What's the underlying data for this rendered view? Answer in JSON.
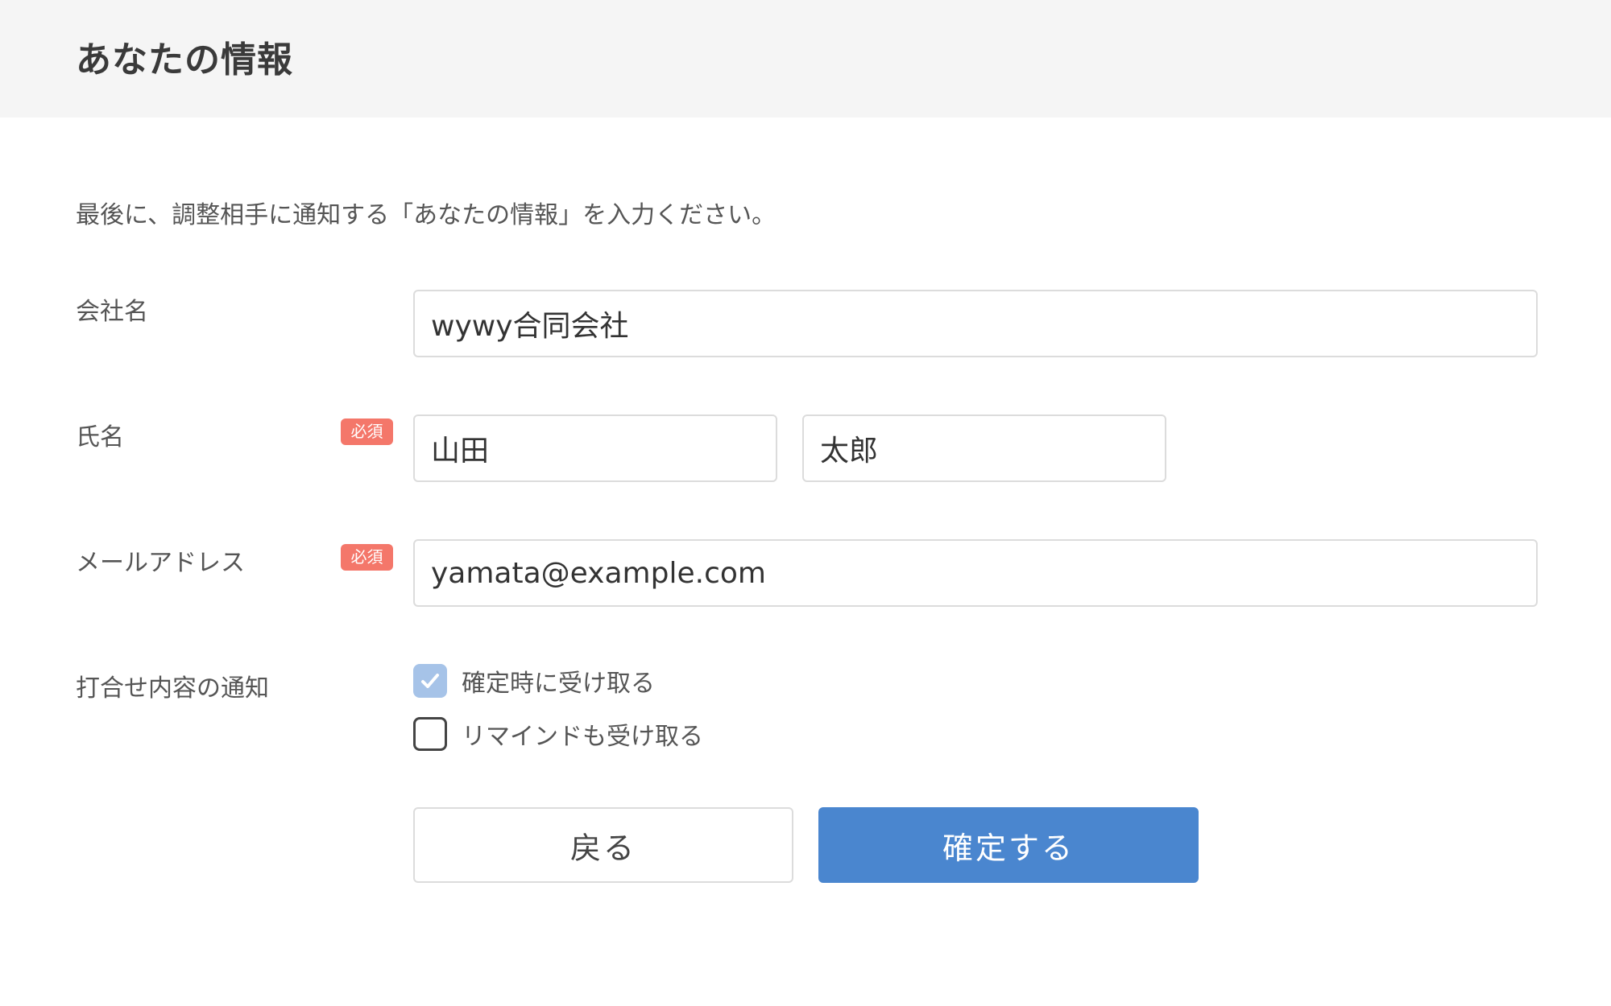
{
  "header": {
    "title": "あなたの情報"
  },
  "intro": "最後に、調整相手に通知する「あなたの情報」を入力ください。",
  "fields": {
    "company": {
      "label": "会社名",
      "value": "wywy合同会社"
    },
    "name": {
      "label": "氏名",
      "badge": "必須",
      "last_name": "山田",
      "first_name": "太郎"
    },
    "email": {
      "label": "メールアドレス",
      "badge": "必須",
      "value": "yamata@example.com"
    }
  },
  "notify": {
    "label": "打合せ内容の通知",
    "options": [
      {
        "label": "確定時に受け取る",
        "checked": true
      },
      {
        "label": "リマインドも受け取る",
        "checked": false
      }
    ]
  },
  "buttons": {
    "back": "戻る",
    "confirm": "確定する"
  },
  "colors": {
    "header_bg": "#f5f5f5",
    "required_badge": "#f4776a",
    "primary": "#4a86cf",
    "checkbox_checked": "#a6c3e8"
  }
}
